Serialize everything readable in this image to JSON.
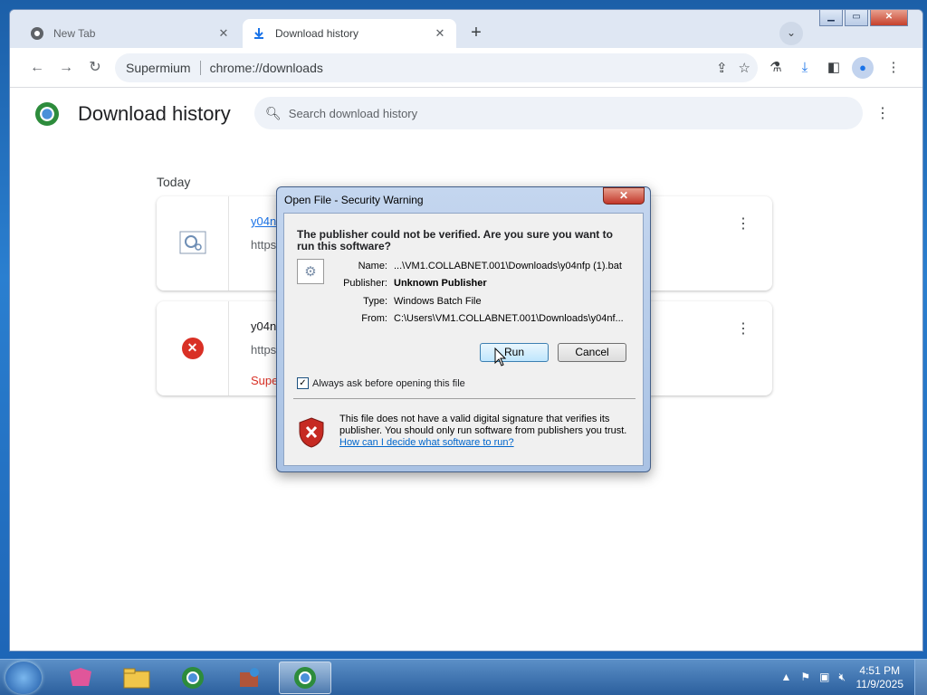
{
  "browser": {
    "tabs": [
      {
        "label": "New Tab",
        "icon": "chrome-icon",
        "active": false
      },
      {
        "label": "Download history",
        "icon": "download-icon",
        "active": true
      }
    ],
    "toolbar": {
      "site_label": "Supermium",
      "url": "chrome://downloads"
    }
  },
  "downloads": {
    "title": "Download history",
    "search_placeholder": "Search download history",
    "group_label": "Today",
    "items": [
      {
        "name": "y04n",
        "source": "https",
        "status": ""
      },
      {
        "name": "y04n",
        "source": "https",
        "status": "Supe"
      }
    ]
  },
  "dialog": {
    "title": "Open File - Security Warning",
    "headline": "The publisher could not be verified.  Are you sure you want to run this software?",
    "fields": [
      {
        "label": "Name:",
        "value": "...\\VM1.COLLABNET.001\\Downloads\\y04nfp (1).bat",
        "bold": false
      },
      {
        "label": "Publisher:",
        "value": "Unknown Publisher",
        "bold": true
      },
      {
        "label": "Type:",
        "value": "Windows Batch File",
        "bold": false
      },
      {
        "label": "From:",
        "value": "C:\\Users\\VM1.COLLABNET.001\\Downloads\\y04nf...",
        "bold": false
      }
    ],
    "run_label": "Run",
    "cancel_label": "Cancel",
    "checkbox_label": "Always ask before opening this file",
    "checkbox_checked": true,
    "footer_text": "This file does not have a valid digital signature that verifies its publisher.  You should only run software from publishers you trust.",
    "footer_link": "How can I decide what software to run?"
  },
  "taskbar": {
    "time": "4:51 PM",
    "date": "11/9/2025"
  },
  "colors": {
    "accent": "#1a73e8",
    "error": "#d93025",
    "taskbar": "#2b5f9d"
  }
}
